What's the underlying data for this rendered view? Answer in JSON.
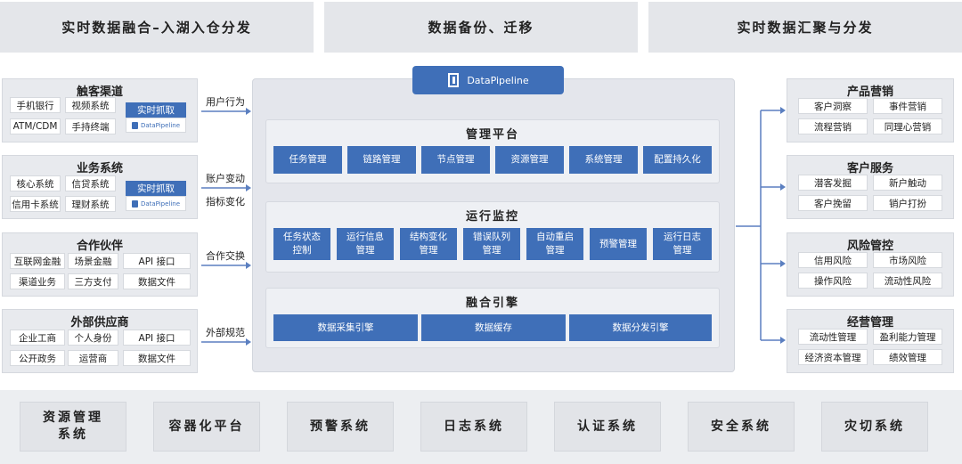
{
  "top": {
    "left": "实时数据融合–入湖入仓分发",
    "middle": "数据备份、迁移",
    "right": "实时数据汇聚与分发"
  },
  "logo_text": "DataPipeline",
  "left_panels": [
    {
      "title": "触客渠道",
      "items": [
        "手机银行",
        "视频系统",
        "ATM/CDM",
        "手持终端"
      ],
      "capture": "实时抓取",
      "arrow_label": "用户行为"
    },
    {
      "title": "业务系统",
      "items": [
        "核心系统",
        "信贷系统",
        "信用卡系统",
        "理财系统"
      ],
      "capture": "实时抓取",
      "arrow_label_1": "账户变动",
      "arrow_label_2": "指标变化"
    },
    {
      "title": "合作伙伴",
      "items": [
        "互联网金融",
        "场景金融",
        "API 接口",
        "渠道业务",
        "三方支付",
        "数据文件"
      ],
      "arrow_label": "合作交换"
    },
    {
      "title": "外部供应商",
      "items": [
        "企业工商",
        "个人身份",
        "API 接口",
        "公开政务",
        "运营商",
        "数据文件"
      ],
      "arrow_label": "外部规范"
    }
  ],
  "center": {
    "management": {
      "title": "管理平台",
      "items": [
        "任务管理",
        "链路管理",
        "节点管理",
        "资源管理",
        "系统管理",
        "配置持久化"
      ]
    },
    "monitoring": {
      "title": "运行监控",
      "items": [
        [
          "任务状态",
          "控制"
        ],
        [
          "运行信息",
          "管理"
        ],
        [
          "结构变化",
          "管理"
        ],
        [
          "错误队列",
          "管理"
        ],
        [
          "自动重启",
          "管理"
        ],
        [
          "预警管理",
          ""
        ],
        [
          "运行日志",
          "管理"
        ]
      ]
    },
    "engine": {
      "title": "融合引擎",
      "items": [
        "数据采集引擎",
        "数据缓存",
        "数据分发引擎"
      ]
    }
  },
  "right_panels": [
    {
      "title": "产品营销",
      "items": [
        "客户洞察",
        "事件营销",
        "流程营销",
        "同理心营销"
      ]
    },
    {
      "title": "客户服务",
      "items": [
        "潜客发掘",
        "新户触动",
        "客户挽留",
        "销户打扮"
      ]
    },
    {
      "title": "风险管控",
      "items": [
        "信用风险",
        "市场风险",
        "操作风险",
        "流动性风险"
      ]
    },
    {
      "title": "经营管理",
      "items": [
        "流动性管理",
        "盈利能力管理",
        "经济资本管理",
        "绩效管理"
      ]
    }
  ],
  "bottom": [
    [
      "资源管理",
      "系统"
    ],
    [
      "容器化平台",
      ""
    ],
    [
      "预警系统",
      ""
    ],
    [
      "日志系统",
      ""
    ],
    [
      "认证系统",
      ""
    ],
    [
      "安全系统",
      ""
    ],
    [
      "灾切系统",
      ""
    ]
  ],
  "colors": {
    "accent": "#3f6fb8",
    "panel_bg": "#e8eaee",
    "banner_bg": "#e4e6ea"
  },
  "icons": [
    "datapipeline-logo-icon",
    "arrow-right-icon"
  ]
}
